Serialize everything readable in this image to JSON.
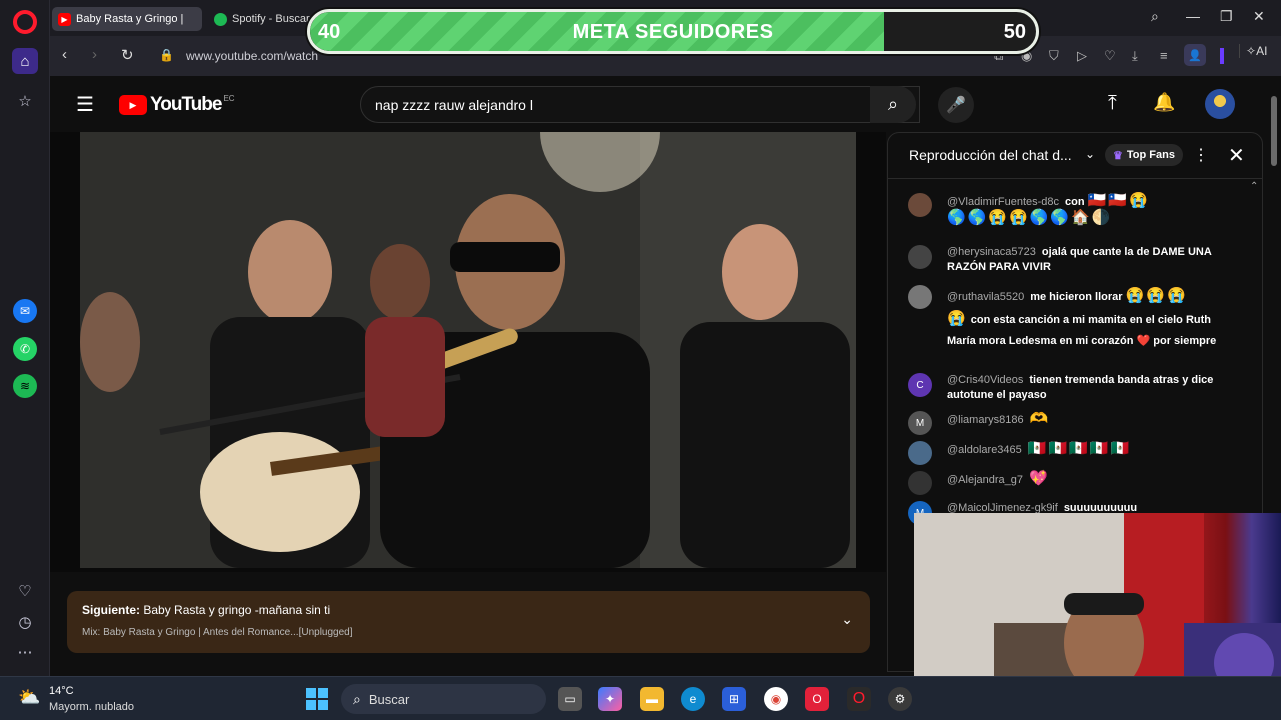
{
  "browser": {
    "tabs": [
      {
        "label": "Baby Rasta y Gringo |",
        "icon": "youtube-icon"
      },
      {
        "label": "Spotify - Buscar",
        "icon": "spotify-icon"
      }
    ],
    "url": "www.youtube.com/watch",
    "ai_label": "AI"
  },
  "overlay": {
    "start": "40",
    "title": "META SEGUIDORES",
    "goal": "50",
    "progress_fraction": 0.79
  },
  "youtube": {
    "logo_text": "YouTube",
    "country": "EC",
    "search_value": "nap zzzz rauw alejandro l"
  },
  "next_up": {
    "prefix": "Siguiente:",
    "title": "Baby Rasta y gringo -mañana sin ti",
    "subtitle": "Mix: Baby Rasta y Gringo | Antes del Romance...[Unplugged]"
  },
  "chat": {
    "title": "Reproducción del chat d...",
    "top_fans": "Top Fans",
    "messages": [
      {
        "user": "@VladimirFuentes-d8c",
        "text": "con",
        "emoji": "🇨🇱🇨🇱😭",
        "emoji2": "🌎🌎😭😭🌎🌎🏠🌗",
        "avatar_color": "#6b4a3a",
        "initial": ""
      },
      {
        "user": "@herysinaca5723",
        "text": "ojalá que cante la de DAME UNA RAZÓN PARA VIVIR",
        "avatar_color": "#444",
        "initial": ""
      },
      {
        "user": "@ruthavila5520",
        "text": "me hicieron llorar",
        "emoji": "😭😭😭",
        "text2": "con esta canción a mi mamita en el cielo Ruth María mora Ledesma en mi corazón ❤️ por siempre",
        "emoji2": "😭",
        "avatar_color": "#777",
        "initial": ""
      },
      {
        "user": "@Cris40Videos",
        "text": "tienen tremenda banda atras y dice autotune el payaso",
        "avatar_color": "#5e35b1",
        "initial": "C"
      },
      {
        "user": "@liamarys8186",
        "text": "",
        "emoji": "🫶",
        "avatar_color": "#555",
        "initial": "M"
      },
      {
        "user": "@aldolare3465",
        "text": "",
        "emoji": "🇲🇽🇲🇽🇲🇽🇲🇽🇲🇽",
        "avatar_color": "#4a6a8a",
        "initial": ""
      },
      {
        "user": "@Alejandra_g7",
        "text": "",
        "emoji": "💖",
        "avatar_color": "#333",
        "initial": ""
      },
      {
        "user": "@MaicolJimenez-gk9if",
        "text": "suuuuuuuuuu",
        "avatar_color": "#1565c0",
        "initial": "M"
      }
    ]
  },
  "taskbar": {
    "temp": "14°C",
    "weather": "Mayorm. nublado",
    "search_placeholder": "Buscar"
  }
}
